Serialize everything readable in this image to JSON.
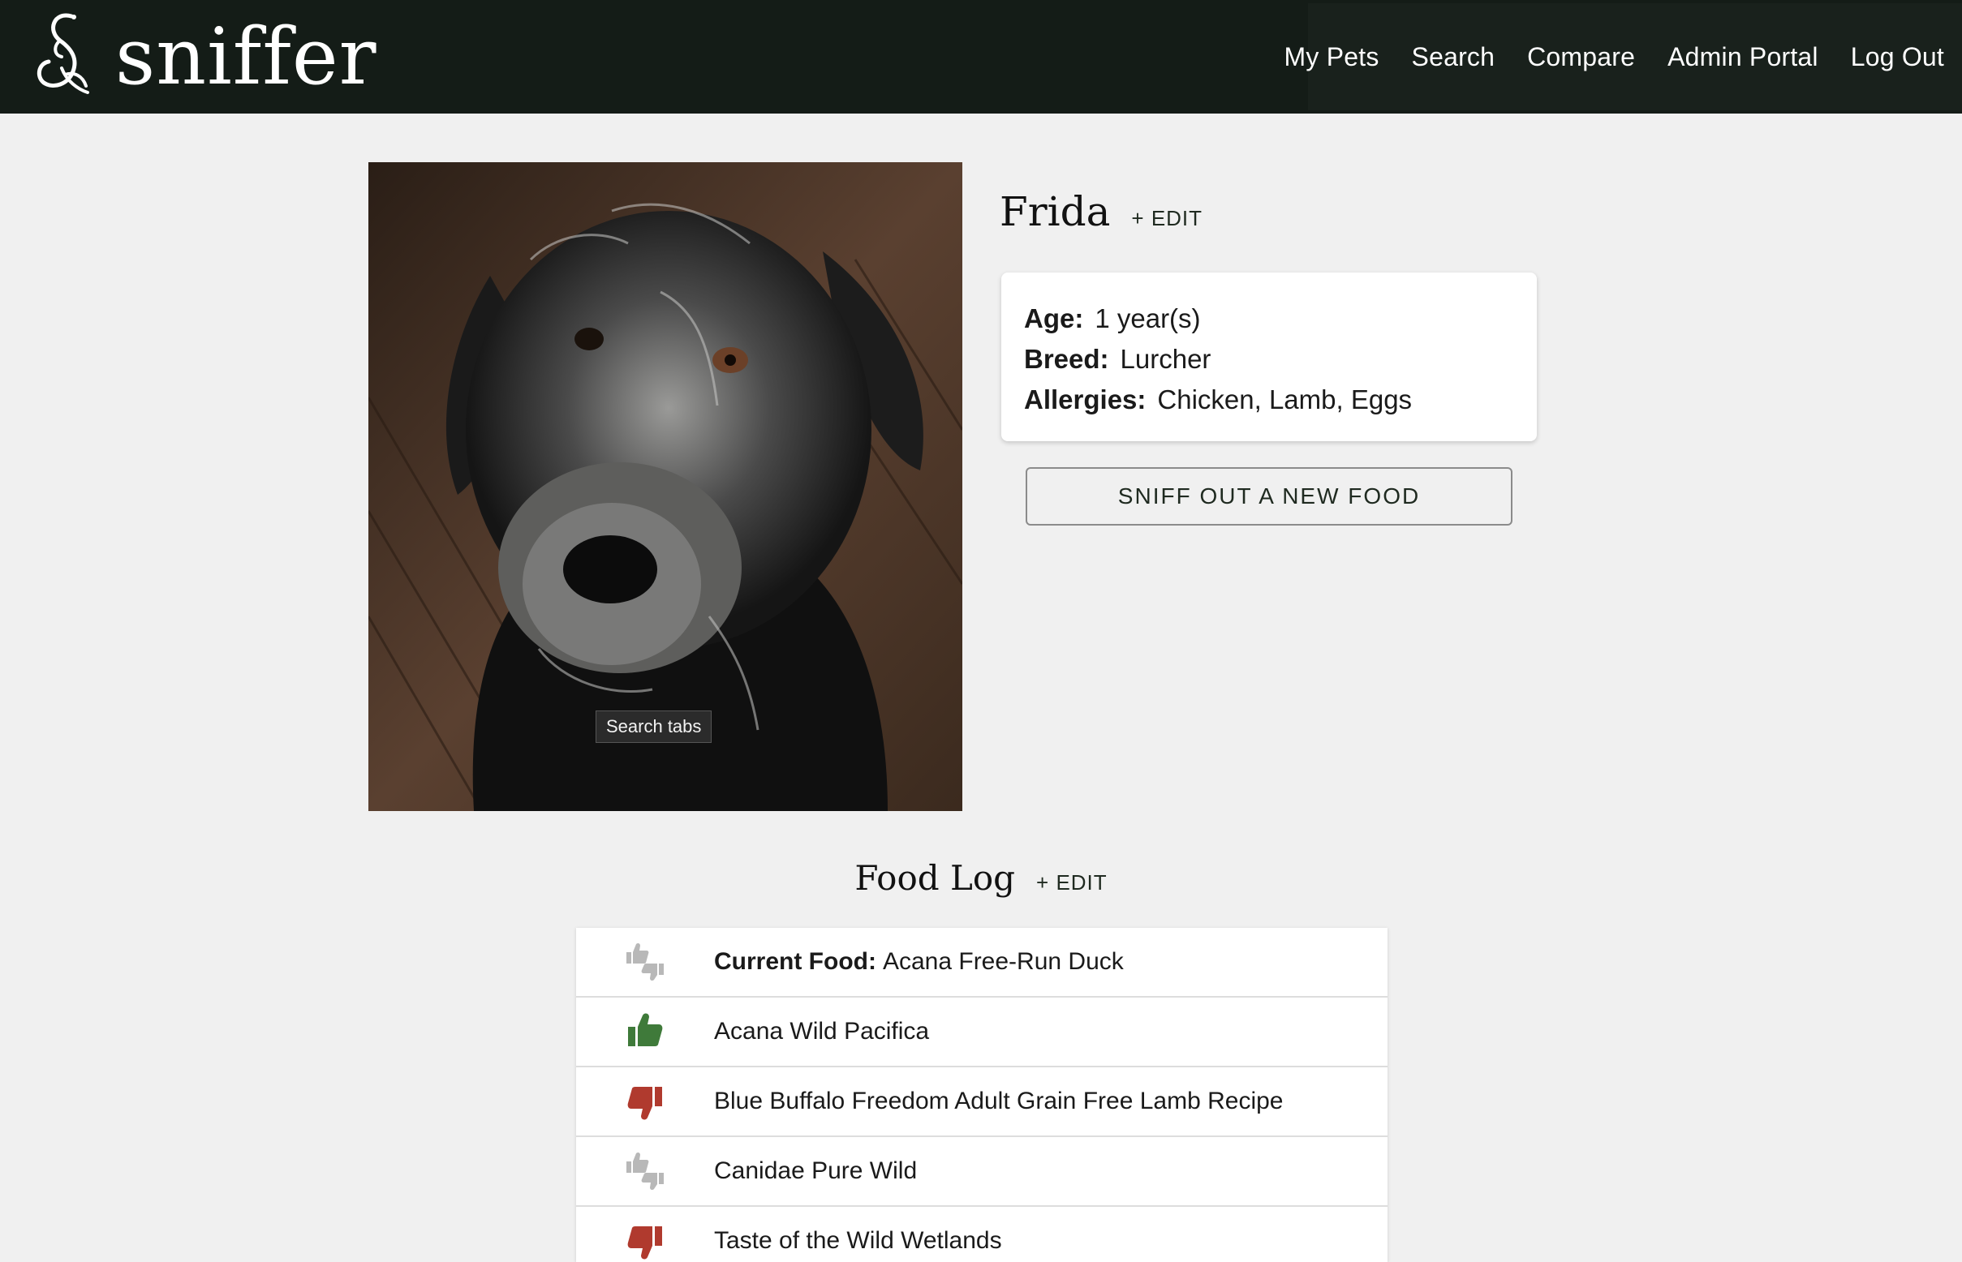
{
  "app": {
    "brand": "sniffer",
    "logo_icon": "sniffer-logo-icon"
  },
  "nav": {
    "links": [
      "My Pets",
      "Search",
      "Compare",
      "Admin Portal",
      "Log Out"
    ]
  },
  "pet": {
    "name": "Frida",
    "edit_label": "+ EDIT",
    "age_label": "Age:",
    "age_value": "1 year(s)",
    "breed_label": "Breed:",
    "breed_value": "Lurcher",
    "allergies_label": "Allergies:",
    "allergies_value": "Chicken, Lamb, Eggs",
    "photo_tooltip": "Search tabs"
  },
  "actions": {
    "sniff_button": "SNIFF OUT A NEW FOOD"
  },
  "food_log": {
    "title": "Food Log",
    "edit_label": "+ EDIT",
    "current_label": "Current Food:",
    "items": [
      {
        "rating": "neutral",
        "icon": "thumbs-neutral-icon",
        "name": "Acana Free-Run Duck",
        "current": true
      },
      {
        "rating": "liked",
        "icon": "thumbs-up-icon",
        "name": "Acana Wild Pacifica"
      },
      {
        "rating": "disliked",
        "icon": "thumbs-down-icon",
        "name": "Blue Buffalo Freedom Adult Grain Free Lamb Recipe"
      },
      {
        "rating": "neutral",
        "icon": "thumbs-neutral-icon",
        "name": "Canidae Pure Wild"
      },
      {
        "rating": "disliked",
        "icon": "thumbs-down-icon",
        "name": "Taste of the Wild Wetlands"
      }
    ]
  },
  "colors": {
    "nav_bg": "#141c17",
    "page_bg": "#f0f0f0",
    "liked": "#3f7a3a",
    "disliked": "#b03a2e",
    "neutral": "#b8b8b8"
  }
}
